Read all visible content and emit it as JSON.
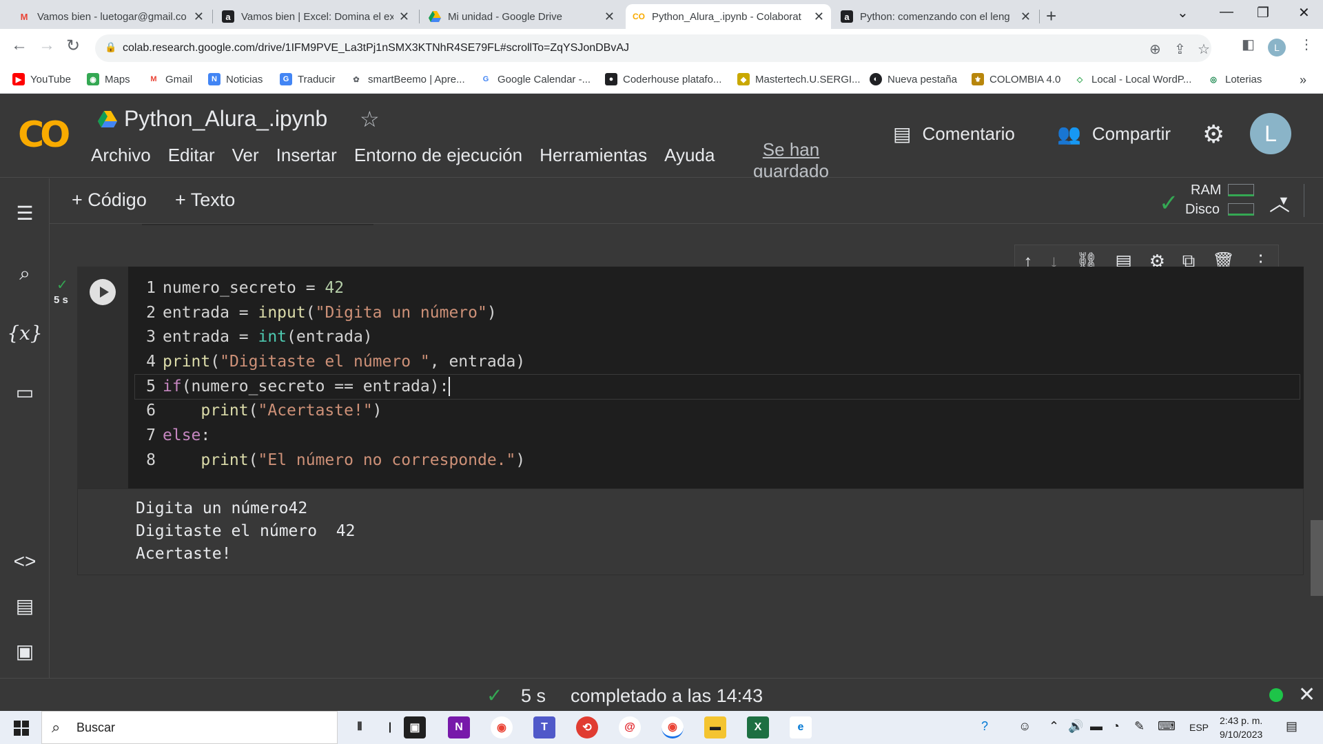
{
  "browser": {
    "tabs": [
      {
        "title": "Vamos bien - luetogar@gmail.co",
        "icon": "gmail-icon",
        "active": false
      },
      {
        "title": "Vamos bien | Excel: Domina el ex",
        "icon": "alura-icon",
        "active": false
      },
      {
        "title": "Mi unidad - Google Drive",
        "icon": "drive-icon",
        "active": false
      },
      {
        "title": "Python_Alura_.ipynb - Colaborat",
        "icon": "colab-icon",
        "active": true
      },
      {
        "title": "Python: comenzando con el leng",
        "icon": "alura-icon",
        "active": false
      }
    ],
    "url": "colab.research.google.com/drive/1IFM9PVE_La3tPj1nSMX3KTNhR4SE79FL#scrollTo=ZqYSJonDBvAJ",
    "profile_initial": "L",
    "bookmarks": [
      {
        "label": "YouTube",
        "color": "#ff0000"
      },
      {
        "label": "Maps",
        "color": "#34a853"
      },
      {
        "label": "Gmail",
        "color": "#ea4335"
      },
      {
        "label": "Noticias",
        "color": "#4285f4"
      },
      {
        "label": "Traducir",
        "color": "#4285f4"
      },
      {
        "label": "smartBeemo | Apre...",
        "color": "#5f6368"
      },
      {
        "label": "Google Calendar -...",
        "color": "#4285f4"
      },
      {
        "label": "Coderhouse platafo...",
        "color": "#202124"
      },
      {
        "label": "Mastertech.U.SERGI...",
        "color": "#c9a800"
      },
      {
        "label": "Nueva pestaña",
        "color": "#202124"
      },
      {
        "label": "COLOMBIA 4.0",
        "color": "#b8860b"
      },
      {
        "label": "Local - Local WordP...",
        "color": "#34a853"
      },
      {
        "label": "Loterias",
        "color": "#0b8043"
      }
    ]
  },
  "colab": {
    "notebook_title": "Python_Alura_.ipynb",
    "menu": [
      "Archivo",
      "Editar",
      "Ver",
      "Insertar",
      "Entorno de ejecución",
      "Herramientas",
      "Ayuda"
    ],
    "saved_status": "Se han guardado",
    "comment_label": "Comentario",
    "share_label": "Compartir",
    "account_initial": "L",
    "toolbar": {
      "code_label": "Código",
      "text_label": "Texto",
      "ram_label": "RAM",
      "disk_label": "Disco"
    },
    "cell": {
      "exec_time": "5 s",
      "line_numbers": [
        "1",
        "2",
        "3",
        "4",
        "5",
        "6",
        "7",
        "8"
      ],
      "output": [
        "Digita un número42",
        "Digitaste el número  42",
        "Acertaste!"
      ]
    },
    "status": {
      "time": "5 s",
      "text": "completado a las 14:43"
    }
  },
  "taskbar": {
    "search_placeholder": "Buscar",
    "language": "ESP",
    "time": "2:43 p. m.",
    "date": "9/10/2023"
  }
}
